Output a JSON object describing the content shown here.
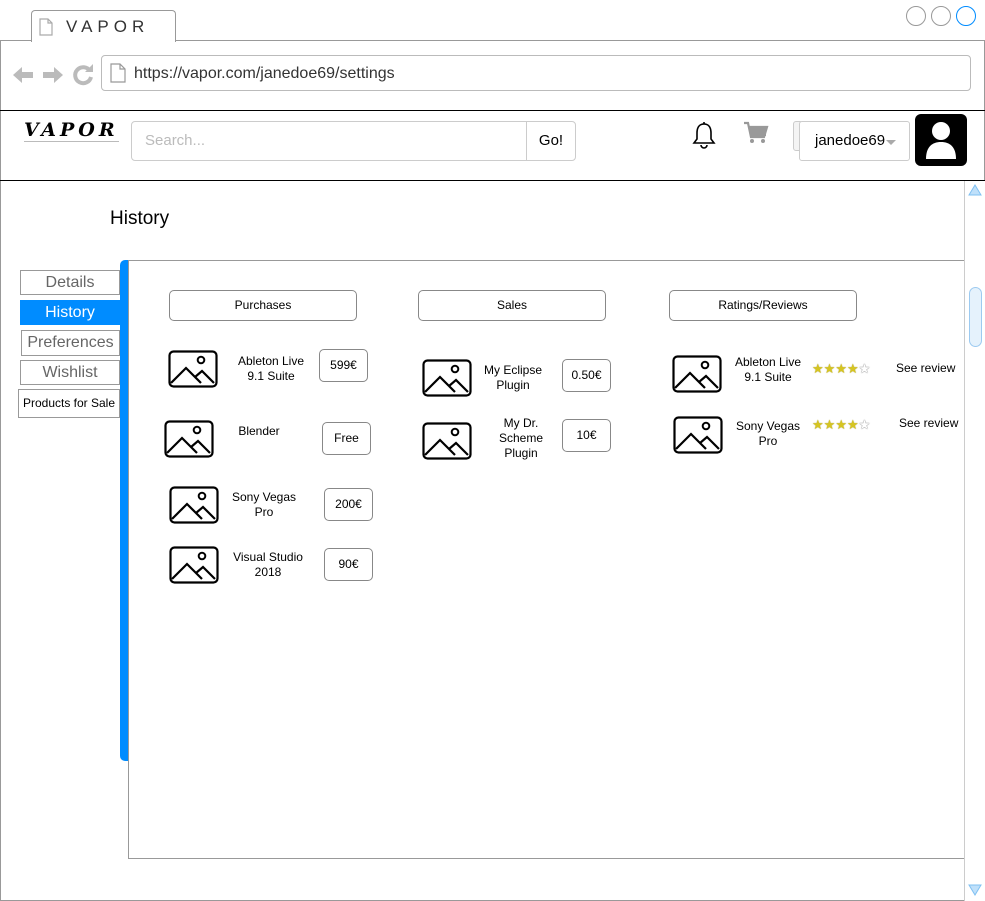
{
  "browser": {
    "tab_title": "VAPOR",
    "url": "https://vapor.com/janedoe69/settings"
  },
  "header": {
    "logo": "VAPOR",
    "search_placeholder": "Search...",
    "go_label": "Go!",
    "username": "janedoe69"
  },
  "page": {
    "title": "History"
  },
  "menu": {
    "items": [
      {
        "label": "Details"
      },
      {
        "label": "History",
        "active": true
      },
      {
        "label": "Preferences"
      },
      {
        "label": "Wishlist"
      },
      {
        "label": "Products for Sale"
      }
    ]
  },
  "columns": {
    "purchases": {
      "title": "Purchases",
      "items": [
        {
          "name": "Ableton Live 9.1 Suite",
          "price": "599€"
        },
        {
          "name": "Blender",
          "price": "Free"
        },
        {
          "name": "Sony Vegas Pro",
          "price": "200€"
        },
        {
          "name": "Visual Studio 2018",
          "price": "90€"
        }
      ]
    },
    "sales": {
      "title": "Sales",
      "items": [
        {
          "name": "My Eclipse Plugin",
          "price": "0.50€"
        },
        {
          "name": "My Dr. Scheme Plugin",
          "price": "10€"
        }
      ]
    },
    "ratings": {
      "title": "Ratings/Reviews",
      "items": [
        {
          "name": "Ableton Live 9.1 Suite",
          "rating": 4,
          "max": 5,
          "link": "See review"
        },
        {
          "name": "Sony Vegas Pro",
          "rating": 4,
          "max": 5,
          "link": "See review"
        }
      ]
    }
  },
  "colors": {
    "accent": "#008cff",
    "star": "#d6c521"
  }
}
